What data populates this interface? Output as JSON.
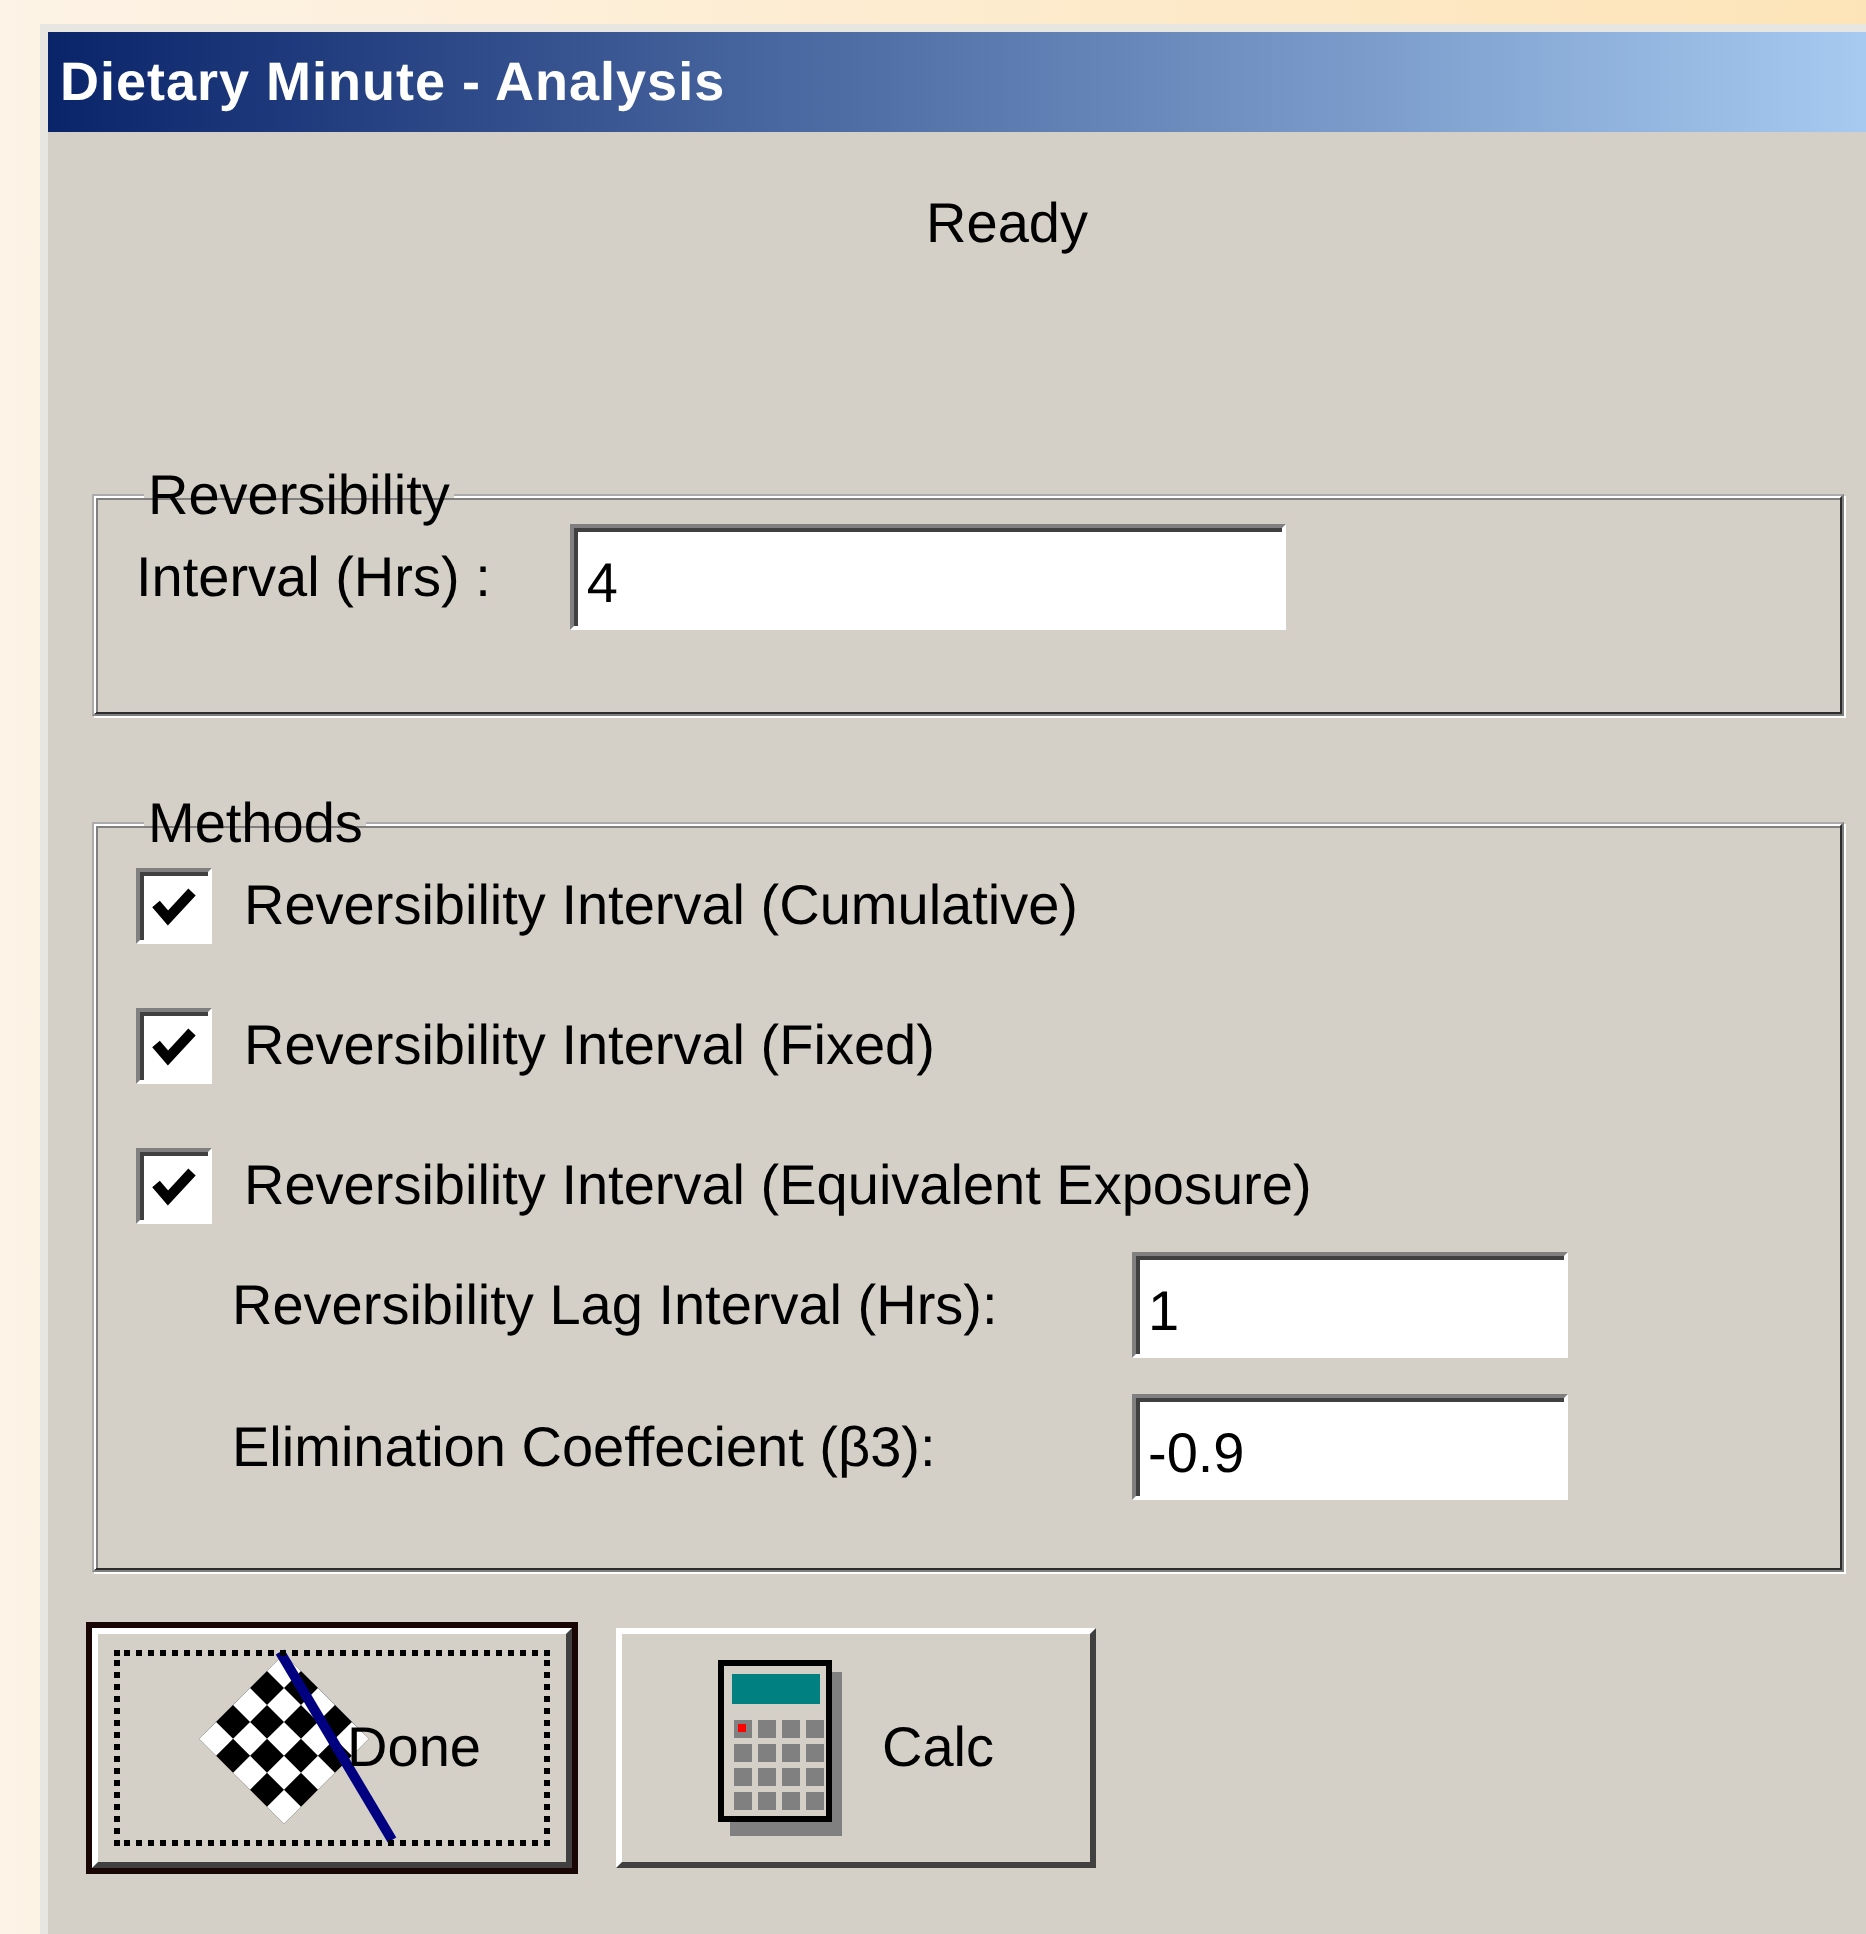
{
  "window": {
    "title": "Dietary Minute - Analysis"
  },
  "status": "Ready",
  "reversibility": {
    "legend": "Reversibility",
    "field": {
      "label": "Interval (Hrs) :",
      "value": "4"
    }
  },
  "methods": {
    "legend": "Methods",
    "checkboxes": [
      {
        "label": "Reversibility Interval (Cumulative)",
        "checked": true
      },
      {
        "label": "Reversibility Interval (Fixed)",
        "checked": true
      },
      {
        "label": "Reversibility Interval (Equivalent Exposure)",
        "checked": true
      }
    ],
    "fields": [
      {
        "label": "Reversibility Lag Interval (Hrs):",
        "value": "1"
      },
      {
        "label": "Elimination Coeffecient (β3):",
        "value": "-0.9"
      }
    ]
  },
  "buttons": [
    {
      "label": "Done",
      "kind": "flag",
      "focused": true
    },
    {
      "label": "Calc",
      "kind": "calculator",
      "focused": false
    }
  ]
}
